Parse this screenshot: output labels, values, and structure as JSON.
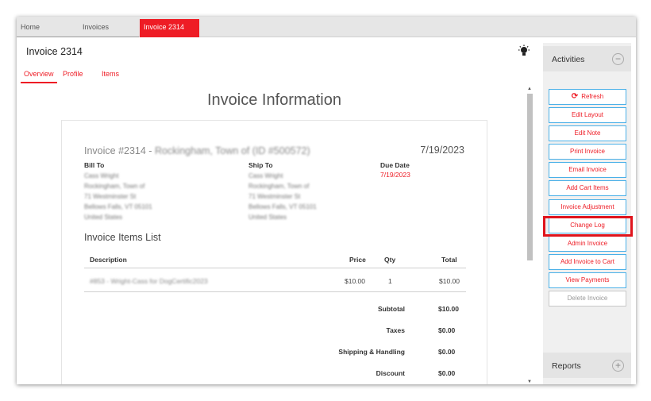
{
  "tabs": {
    "home": "Home",
    "invoices": "Invoices",
    "current": "Invoice 2314"
  },
  "page": {
    "title": "Invoice 2314",
    "subtabs": [
      "Overview",
      "Profile",
      "Items"
    ],
    "heading": "Invoice Information"
  },
  "invoice": {
    "number_prefix": "Invoice #2314 - ",
    "customer_name": "Rockingham, Town of (ID #500572)",
    "date": "7/19/2023",
    "bill_to": {
      "label": "Bill To",
      "lines": [
        "Cass Wright",
        "Rockingham, Town of",
        "71 Westminster St",
        "Bellows Falls, VT 05101",
        "United States"
      ]
    },
    "ship_to": {
      "label": "Ship To",
      "lines": [
        "Cass Wright",
        "Rockingham, Town of",
        "71 Westminster St",
        "Bellows Falls, VT 05101",
        "United States"
      ]
    },
    "due_date": {
      "label": "Due Date",
      "value": "7/19/2023"
    },
    "items_heading": "Invoice Items List",
    "columns": {
      "description": "Description",
      "price": "Price",
      "qty": "Qty",
      "total": "Total"
    },
    "items": [
      {
        "description": "#853 - Wright-Cass for DogCertific2023",
        "price": "$10.00",
        "qty": "1",
        "total": "$10.00"
      }
    ],
    "summary": {
      "subtotal_label": "Subtotal",
      "subtotal": "$10.00",
      "taxes_label": "Taxes",
      "taxes": "$0.00",
      "shipping_label": "Shipping & Handling",
      "shipping": "$0.00",
      "discount_label": "Discount",
      "discount": "$0.00"
    }
  },
  "activities": {
    "title": "Activities",
    "buttons": [
      "Refresh",
      "Edit Layout",
      "Edit Note",
      "Print Invoice",
      "Email Invoice",
      "Add Cart Items",
      "Invoice Adjustment",
      "Change Log",
      "Admin Invoice",
      "Add Invoice to Cart",
      "View Payments",
      "Delete Invoice"
    ],
    "collapse_symbol": "−"
  },
  "reports": {
    "title": "Reports",
    "expand_symbol": "+"
  },
  "colors": {
    "accent": "#ee1c25",
    "button_border": "#4ab0e8",
    "highlight": "#e0141c"
  }
}
